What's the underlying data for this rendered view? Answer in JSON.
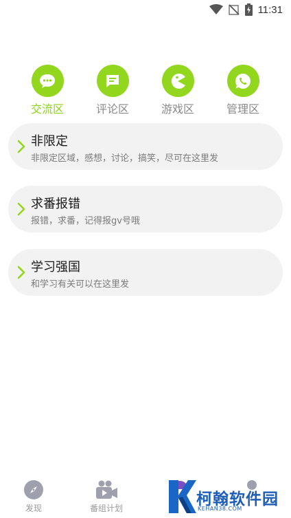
{
  "status_bar": {
    "time": "11:31",
    "icons": [
      "wifi-icon",
      "signal-off-icon",
      "battery-charging-icon"
    ]
  },
  "categories": [
    {
      "label": "交流区",
      "icon": "chat-bubble-icon",
      "active": true
    },
    {
      "label": "评论区",
      "icon": "comment-icon",
      "active": false
    },
    {
      "label": "游戏区",
      "icon": "pacman-icon",
      "active": false
    },
    {
      "label": "管理区",
      "icon": "whatsapp-phone-icon",
      "active": false
    }
  ],
  "boards": [
    {
      "title": "非限定",
      "desc": "非限定区域，感想，讨论，搞笑，尽可在这里发"
    },
    {
      "title": "求番报错",
      "desc": "报错，求番，记得报gv号哦"
    },
    {
      "title": "学习强国",
      "desc": "和学习有关可以在这里发"
    }
  ],
  "bottom_nav": [
    {
      "label": "发现",
      "icon": "compass-icon"
    },
    {
      "label": "番组计划",
      "icon": "video-camera-icon"
    },
    {
      "label": "",
      "icon": "umbrella-icon"
    },
    {
      "label": "",
      "icon": "user-icon"
    }
  ],
  "watermark": {
    "brand": "柯翰软件园",
    "domain": "KEHAN38.COM"
  },
  "colors": {
    "accent": "#92d61e",
    "accent_text": "#8dd41b",
    "card_bg": "#f2f2f2",
    "muted": "#8a8a8a",
    "watermark_blue": "#1d5fb8"
  }
}
